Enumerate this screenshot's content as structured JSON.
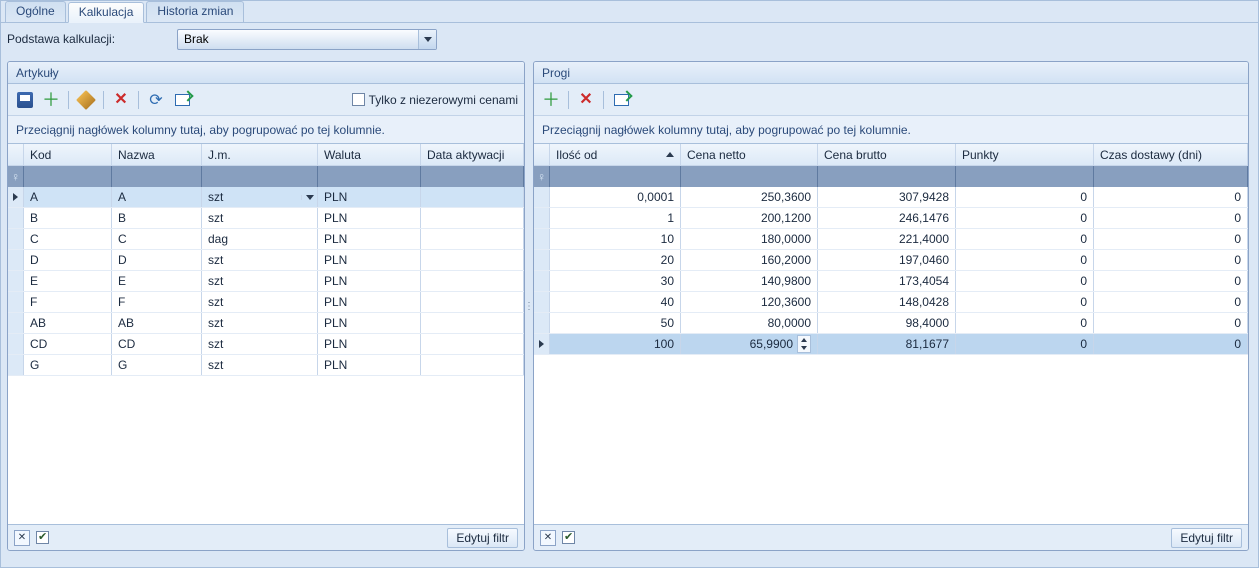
{
  "tabs": {
    "a": "Ogólne",
    "b": "Kalkulacja",
    "c": "Historia zmian"
  },
  "param": {
    "label": "Podstawa kalkulacji:",
    "value": "Brak"
  },
  "left": {
    "title": "Artykuły",
    "nonzero": "Tylko z niezerowymi cenami",
    "group_hint": "Przeciągnij nagłówek kolumny tutaj, aby pogrupować po tej kolumnie.",
    "cols": {
      "kod": "Kod",
      "nazwa": "Nazwa",
      "jm": "J.m.",
      "waluta": "Waluta",
      "data": "Data aktywacji"
    },
    "rows": [
      {
        "kod": "A",
        "nazwa": "A",
        "jm": "szt",
        "waluta": "PLN",
        "data": ""
      },
      {
        "kod": "B",
        "nazwa": "B",
        "jm": "szt",
        "waluta": "PLN",
        "data": ""
      },
      {
        "kod": "C",
        "nazwa": "C",
        "jm": "dag",
        "waluta": "PLN",
        "data": ""
      },
      {
        "kod": "D",
        "nazwa": "D",
        "jm": "szt",
        "waluta": "PLN",
        "data": ""
      },
      {
        "kod": "E",
        "nazwa": "E",
        "jm": "szt",
        "waluta": "PLN",
        "data": ""
      },
      {
        "kod": "F",
        "nazwa": "F",
        "jm": "szt",
        "waluta": "PLN",
        "data": ""
      },
      {
        "kod": "AB",
        "nazwa": "AB",
        "jm": "szt",
        "waluta": "PLN",
        "data": ""
      },
      {
        "kod": "CD",
        "nazwa": "CD",
        "jm": "szt",
        "waluta": "PLN",
        "data": ""
      },
      {
        "kod": "G",
        "nazwa": "G",
        "jm": "szt",
        "waluta": "PLN",
        "data": ""
      }
    ],
    "edit_filter": "Edytuj filtr"
  },
  "right": {
    "title": "Progi",
    "group_hint": "Przeciągnij nagłówek kolumny tutaj, aby pogrupować po tej kolumnie.",
    "cols": {
      "ilosc": "Ilość od",
      "cn": "Cena netto",
      "cb": "Cena brutto",
      "p": "Punkty",
      "cz": "Czas dostawy (dni)"
    },
    "rows": [
      {
        "ilosc": "0,0001",
        "cn": "250,3600",
        "cb": "307,9428",
        "p": "0",
        "cz": "0"
      },
      {
        "ilosc": "1",
        "cn": "200,1200",
        "cb": "246,1476",
        "p": "0",
        "cz": "0"
      },
      {
        "ilosc": "10",
        "cn": "180,0000",
        "cb": "221,4000",
        "p": "0",
        "cz": "0"
      },
      {
        "ilosc": "20",
        "cn": "160,2000",
        "cb": "197,0460",
        "p": "0",
        "cz": "0"
      },
      {
        "ilosc": "30",
        "cn": "140,9800",
        "cb": "173,4054",
        "p": "0",
        "cz": "0"
      },
      {
        "ilosc": "40",
        "cn": "120,3600",
        "cb": "148,0428",
        "p": "0",
        "cz": "0"
      },
      {
        "ilosc": "50",
        "cn": "80,0000",
        "cb": "98,4000",
        "p": "0",
        "cz": "0"
      },
      {
        "ilosc": "100",
        "cn": "65,9900",
        "cb": "81,1677",
        "p": "0",
        "cz": "0"
      }
    ],
    "edit_filter": "Edytuj filtr"
  }
}
